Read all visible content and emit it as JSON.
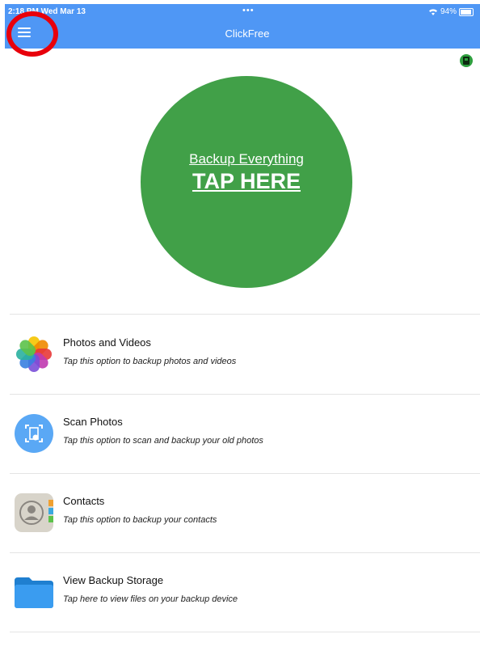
{
  "status_bar": {
    "time": "2:18 PM  Wed Mar 13",
    "dots": "•••",
    "battery_text": "94%"
  },
  "nav": {
    "title": "ClickFree"
  },
  "backup_button": {
    "line1": "Backup Everything",
    "line2": "TAP HERE"
  },
  "options": [
    {
      "title": "Photos and Videos",
      "subtitle": "Tap this option to backup photos and videos",
      "icon": "photos-icon"
    },
    {
      "title": "Scan Photos",
      "subtitle": "Tap this option to scan and backup your old photos",
      "icon": "scan-photos-icon"
    },
    {
      "title": "Contacts",
      "subtitle": "Tap this option to backup your contacts",
      "icon": "contacts-icon"
    },
    {
      "title": "View Backup Storage",
      "subtitle": "Tap here to view files on your backup device",
      "icon": "folder-icon"
    }
  ],
  "colors": {
    "nav": "#4f97f5",
    "backup_green": "#41a048",
    "annotation_red": "#e8000b"
  }
}
